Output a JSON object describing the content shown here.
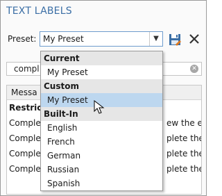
{
  "panel": {
    "title": "TEXT LABELS"
  },
  "preset": {
    "label": "Preset:",
    "value": "My Preset"
  },
  "toolbar": {
    "save_icon": "save-icon",
    "close_icon": "close-icon"
  },
  "search": {
    "value": "compl"
  },
  "grid": {
    "header": {
      "col1": "Messa"
    },
    "group": "Restrict",
    "rows": [
      {
        "left": "Comple",
        "right": "ew the er"
      },
      {
        "left": "Comple",
        "right": "plete the"
      },
      {
        "left": "Comple",
        "right": "plete the"
      },
      {
        "left": "Comple",
        "right": "plete the"
      }
    ]
  },
  "dropdown": {
    "sections": [
      {
        "header": "Current",
        "items": [
          "My Preset"
        ]
      },
      {
        "header": "Custom",
        "items": [
          "My Preset"
        ]
      },
      {
        "header": "Built-In",
        "items": [
          "English",
          "French",
          "German",
          "Russian",
          "Spanish"
        ]
      }
    ],
    "selected": "Custom/My Preset"
  },
  "colors": {
    "title": "#3a6ea5",
    "selection": "#bdd7ef",
    "section_header": "#e6e6e6"
  }
}
